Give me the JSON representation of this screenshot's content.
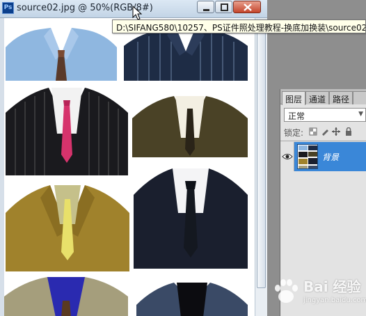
{
  "window": {
    "title": "source02.jpg @ 50%(RGB/8#)",
    "app_icon_label": "Ps"
  },
  "tooltip": {
    "path": "D:\\SIFANG580\\10257、PS证件照处理教程-换底加换装\\source02"
  },
  "layers_panel": {
    "tabs": [
      "图层",
      "通道",
      "路径",
      ""
    ],
    "blend_mode": "正常",
    "lock_label": "锁定:",
    "layers": [
      {
        "name": "背景",
        "visible": true,
        "selected": true
      }
    ]
  },
  "canvas": {
    "suits": [
      {
        "name": "light blue shirt with tie",
        "color": "#8fb7e0"
      },
      {
        "name": "navy striped shirt",
        "color": "#1e2c45"
      },
      {
        "name": "black pinstripe suit with pink tie",
        "color": "#1a1a1e"
      },
      {
        "name": "olive green suit with dark tie",
        "color": "#4a4226"
      },
      {
        "name": "mustard yellow suit",
        "color": "#a0822c"
      },
      {
        "name": "dark navy suit",
        "color": "#1a1f2e"
      },
      {
        "name": "tan suit with blue shirt",
        "color": "#a59e7c"
      },
      {
        "name": "grey-blue suit with black turtleneck",
        "color": "#3a4a66"
      }
    ]
  },
  "watermark": {
    "main": "Bai 经验",
    "sub": "jingyan.baidu.com"
  }
}
